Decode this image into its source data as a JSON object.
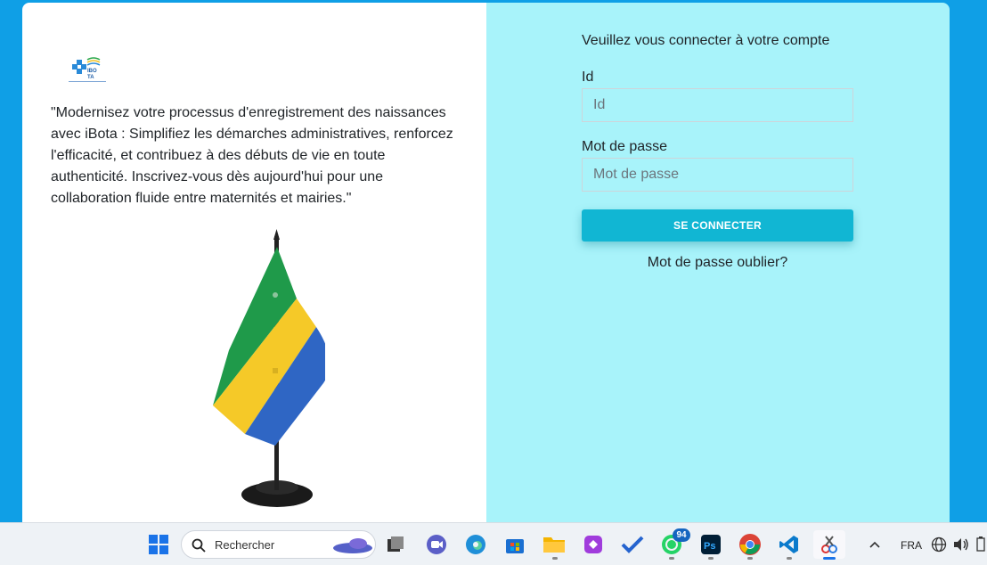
{
  "brand": {
    "logo_text_top": "IBO",
    "logo_text_bottom": "TA"
  },
  "intro": {
    "quote": "\"Modernisez votre processus d'enregistrement des naissances avec iBota : Simplifiez les démarches administratives, renforcez l'efficacité, et contribuez à des débuts de vie en toute authenticité. Inscrivez-vous dès aujourd'hui pour une collaboration fluide entre maternités et mairies.\""
  },
  "login": {
    "title": "Veuillez vous connecter à votre compte",
    "id_label": "Id",
    "id_placeholder": "Id",
    "password_label": "Mot de passe",
    "password_placeholder": "Mot de passe",
    "submit_label": "SE CONNECTER",
    "forgot_label": "Mot de passe oublier?"
  },
  "taskbar": {
    "search_placeholder": "Rechercher",
    "whatsapp_badge": "94",
    "language": "FRA"
  },
  "colors": {
    "page_bg": "#0f9fe6",
    "panel_right": "#a8f3fa",
    "button": "#11b6d3",
    "flag_green": "#1f9a4a",
    "flag_yellow": "#f5c928",
    "flag_blue": "#2f66c4"
  }
}
